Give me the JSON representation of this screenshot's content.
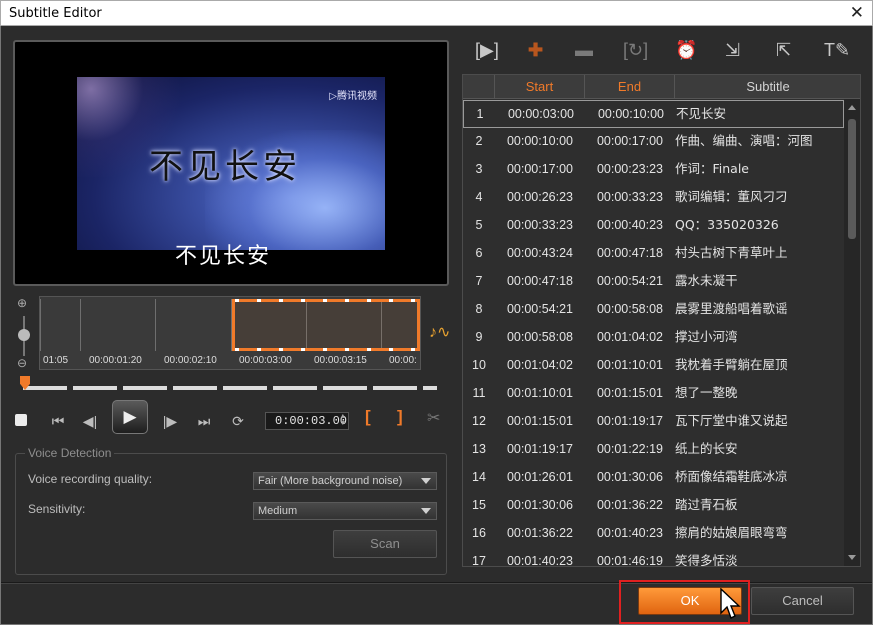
{
  "window": {
    "title": "Subtitle Editor",
    "close_glyph": "✕"
  },
  "preview": {
    "channel_logo": "▷腾讯视频",
    "title_text": "不见长安",
    "subtitle_text": "不见长安"
  },
  "timeline": {
    "labels": [
      "01:05",
      "00:00:01:20",
      "00:00:02:10",
      "00:00:03:00",
      "00:00:03:15",
      "00:00:"
    ]
  },
  "transport": {
    "timecode": "0:00:03.00",
    "mark_in": "[",
    "mark_out": "]"
  },
  "voice_detection": {
    "legend": "Voice Detection",
    "quality_label": "Voice recording quality:",
    "quality_value": "Fair (More background noise)",
    "sensitivity_label": "Sensitivity:",
    "sensitivity_value": "Medium",
    "scan_label": "Scan"
  },
  "table": {
    "headers": {
      "start": "Start",
      "end": "End",
      "subtitle": "Subtitle"
    },
    "rows": [
      {
        "num": "1",
        "start": "00:00:03:00",
        "end": "00:00:10:00",
        "sub": "不见长安"
      },
      {
        "num": "2",
        "start": "00:00:10:00",
        "end": "00:00:17:00",
        "sub": "作曲、编曲、演唱：河图"
      },
      {
        "num": "3",
        "start": "00:00:17:00",
        "end": "00:00:23:23",
        "sub": "作词：Finale"
      },
      {
        "num": "4",
        "start": "00:00:26:23",
        "end": "00:00:33:23",
        "sub": "歌词编辑：董风刁刁"
      },
      {
        "num": "5",
        "start": "00:00:33:23",
        "end": "00:00:40:23",
        "sub": "QQ：335020326"
      },
      {
        "num": "6",
        "start": "00:00:43:24",
        "end": "00:00:47:18",
        "sub": "村头古树下青草叶上"
      },
      {
        "num": "7",
        "start": "00:00:47:18",
        "end": "00:00:54:21",
        "sub": "露水未凝干"
      },
      {
        "num": "8",
        "start": "00:00:54:21",
        "end": "00:00:58:08",
        "sub": "晨雾里渡船唱着歌谣"
      },
      {
        "num": "9",
        "start": "00:00:58:08",
        "end": "00:01:04:02",
        "sub": "撑过小河湾"
      },
      {
        "num": "10",
        "start": "00:01:04:02",
        "end": "00:01:10:01",
        "sub": "我枕着手臂躺在屋顶"
      },
      {
        "num": "11",
        "start": "00:01:10:01",
        "end": "00:01:15:01",
        "sub": "想了一整晚"
      },
      {
        "num": "12",
        "start": "00:01:15:01",
        "end": "00:01:19:17",
        "sub": "瓦下厅堂中谁又说起"
      },
      {
        "num": "13",
        "start": "00:01:19:17",
        "end": "00:01:22:19",
        "sub": "纸上的长安"
      },
      {
        "num": "14",
        "start": "00:01:26:01",
        "end": "00:01:30:06",
        "sub": "桥面像结霜鞋底冰凉"
      },
      {
        "num": "15",
        "start": "00:01:30:06",
        "end": "00:01:36:22",
        "sub": "踏过青石板"
      },
      {
        "num": "16",
        "start": "00:01:36:22",
        "end": "00:01:40:23",
        "sub": "擦肩的姑娘眉眼弯弯"
      },
      {
        "num": "17",
        "start": "00:01:40:23",
        "end": "00:01:46:19",
        "sub": "笑得多恬淡"
      }
    ]
  },
  "footer": {
    "ok_label": "OK",
    "cancel_label": "Cancel"
  },
  "colors": {
    "accent": "#f07a2a",
    "ok_highlight": "#e02020"
  }
}
